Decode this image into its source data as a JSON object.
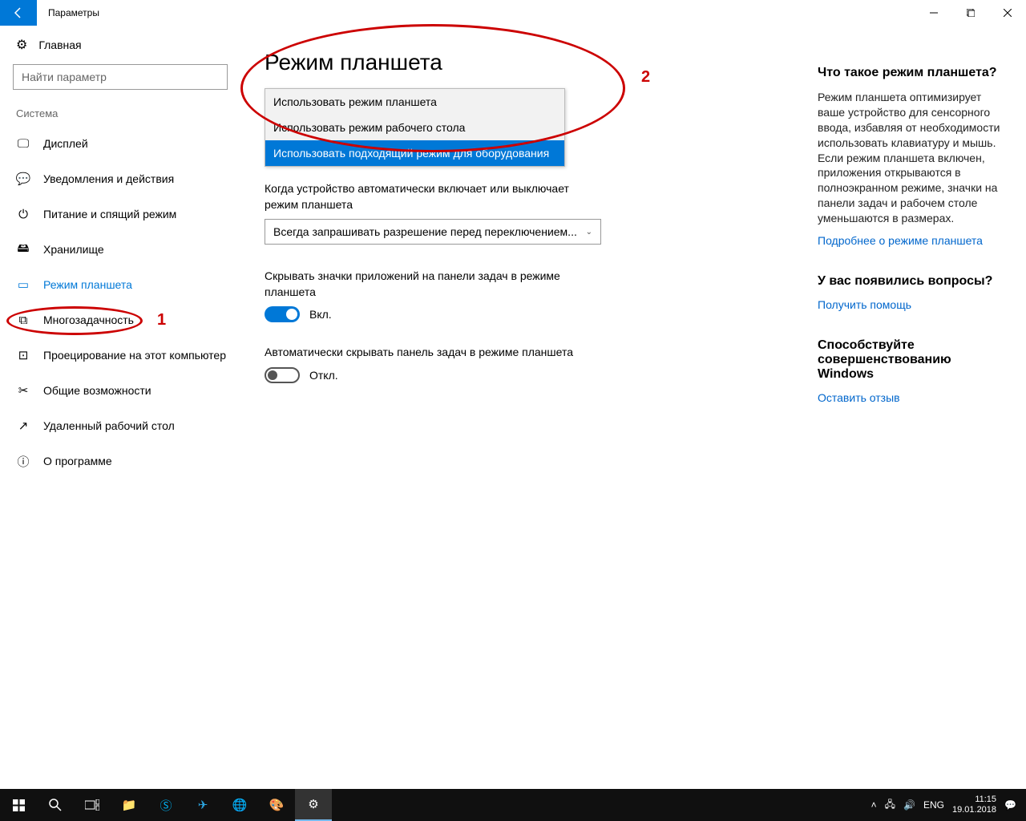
{
  "window": {
    "title": "Параметры"
  },
  "sidebar": {
    "home": "Главная",
    "search_placeholder": "Найти параметр",
    "section": "Система",
    "items": [
      {
        "label": "Дисплей"
      },
      {
        "label": "Уведомления и действия"
      },
      {
        "label": "Питание и спящий режим"
      },
      {
        "label": "Хранилище"
      },
      {
        "label": "Режим планшета"
      },
      {
        "label": "Многозадачность"
      },
      {
        "label": "Проецирование на этот компьютер"
      },
      {
        "label": "Общие возможности"
      },
      {
        "label": "Удаленный рабочий стол"
      },
      {
        "label": "О программе"
      }
    ]
  },
  "main": {
    "title": "Режим планшета",
    "login_dropdown": {
      "options": [
        "Использовать режим планшета",
        "Использовать режим рабочего стола",
        "Использовать подходящий режим для оборудования"
      ]
    },
    "auto_switch_label": "Когда устройство автоматически включает или выключает режим планшета",
    "auto_switch_value": "Всегда запрашивать разрешение перед переключением...",
    "hide_icons_label": "Скрывать значки приложений на панели задач в режиме планшета",
    "hide_icons_state": "Вкл.",
    "auto_hide_label": "Автоматически скрывать панель задач в режиме планшета",
    "auto_hide_state": "Откл."
  },
  "right": {
    "what_title": "Что такое режим планшета?",
    "what_text": "Режим планшета оптимизирует ваше устройство для сенсорного ввода, избавляя от необходимости использовать клавиатуру и мышь. Если режим планшета включен, приложения открываются в полноэкранном режиме, значки на панели задач и рабочем столе уменьшаются в размерах.",
    "what_link": "Подробнее о режиме планшета",
    "questions_title": "У вас появились вопросы?",
    "questions_link": "Получить помощь",
    "improve_title": "Способствуйте совершенствованию Windows",
    "improve_link": "Оставить отзыв"
  },
  "annotations": {
    "num1": "1",
    "num2": "2"
  },
  "taskbar": {
    "lang": "ENG",
    "time": "11:15",
    "date": "19.01.2018"
  }
}
